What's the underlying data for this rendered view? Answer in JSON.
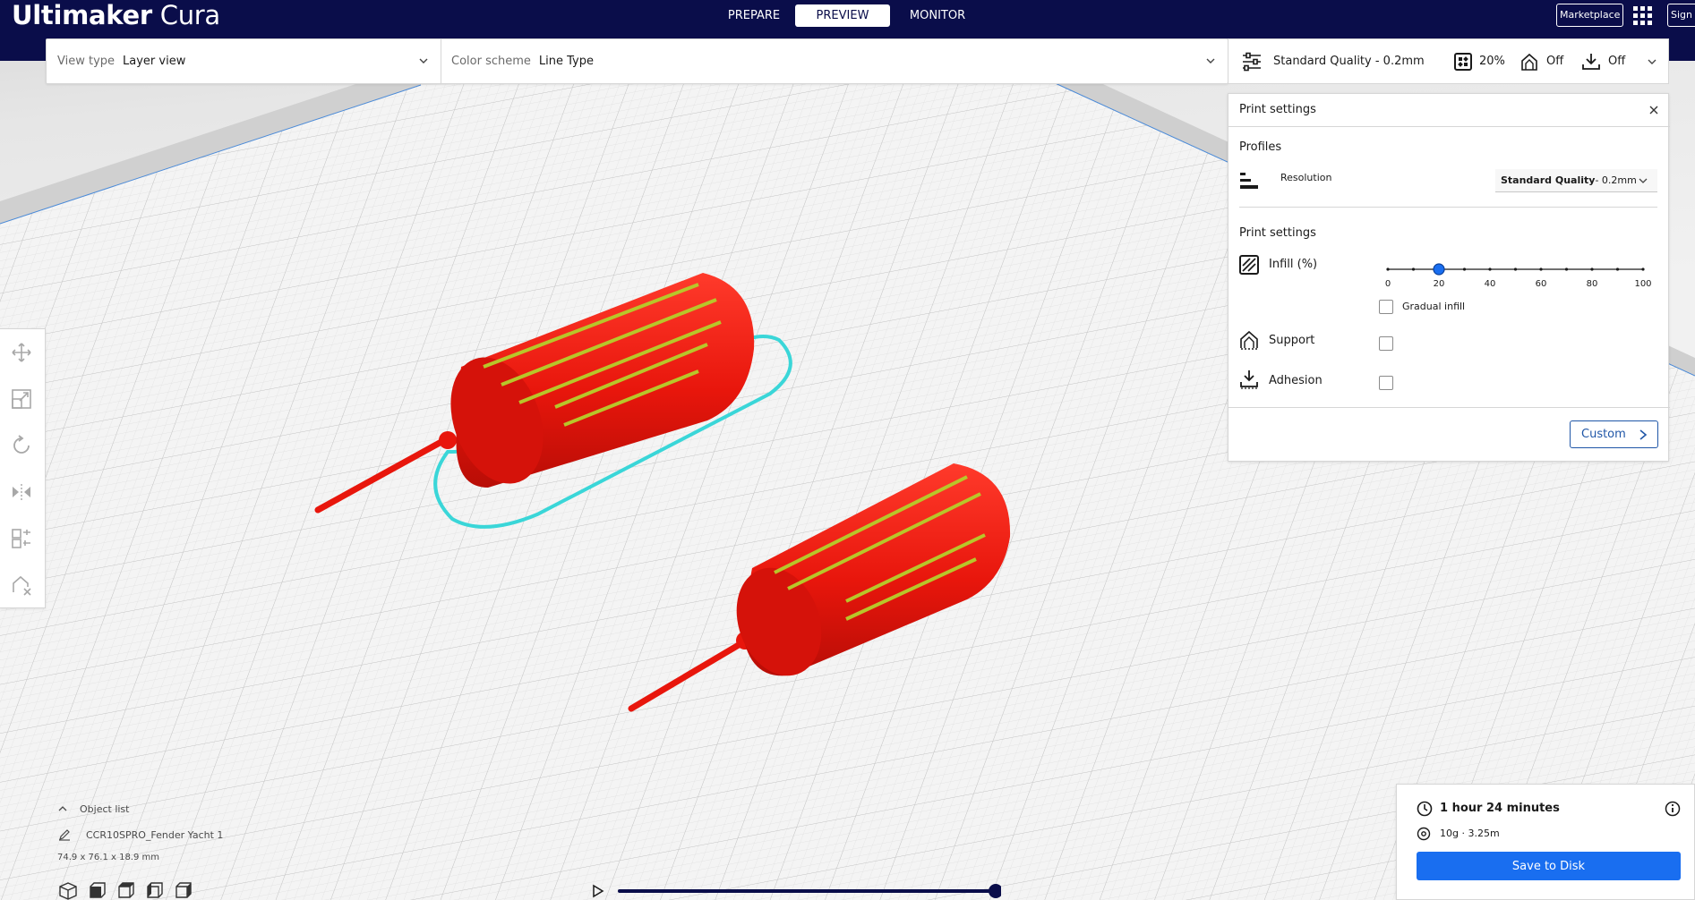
{
  "app": {
    "logo_bold": "Ultimaker",
    "logo_light": "Cura"
  },
  "stages": {
    "prepare": "PREPARE",
    "preview": "PREVIEW",
    "monitor": "MONITOR",
    "active": "PREVIEW"
  },
  "header_right": {
    "marketplace": "Marketplace",
    "sign_in": "Sign"
  },
  "view_bar": {
    "view_type_label": "View type",
    "view_type_value": "Layer view",
    "color_scheme_label": "Color scheme",
    "color_scheme_value": "Line Type"
  },
  "print_header": {
    "profile": "Standard Quality - 0.2mm",
    "infill": "20%",
    "support": "Off",
    "adhesion": "Off"
  },
  "print_panel": {
    "title": "Print settings",
    "profiles_heading": "Profiles",
    "resolution_label": "Resolution",
    "resolution_bold": "Standard Quality",
    "resolution_light": " - 0.2mm",
    "settings_heading": "Print settings",
    "infill_label": "Infill (%)",
    "infill_value": 20,
    "infill_ticks": [
      "0",
      "20",
      "40",
      "60",
      "80",
      "100"
    ],
    "gradual_infill_label": "Gradual infill",
    "gradual_infill_checked": false,
    "support_label": "Support",
    "support_checked": false,
    "adhesion_label": "Adhesion",
    "adhesion_checked": false,
    "custom_button": "Custom"
  },
  "object_list": {
    "toggle_label": "Object list",
    "object_name": "CCR10SPRO_Fender Yacht 1",
    "dimensions": "74.9 x 76.1 x 18.9 mm"
  },
  "estimate": {
    "time": "1 hour 24 minutes",
    "material": "10g · 3.25m",
    "save_button": "Save to Disk"
  },
  "colors": {
    "topbar": "#0a0d4a",
    "accent_blue": "#196ef0",
    "model_red": "#e8160c",
    "infill_yellow": "#b8c62a",
    "skirt_cyan": "#3ad6d8"
  }
}
